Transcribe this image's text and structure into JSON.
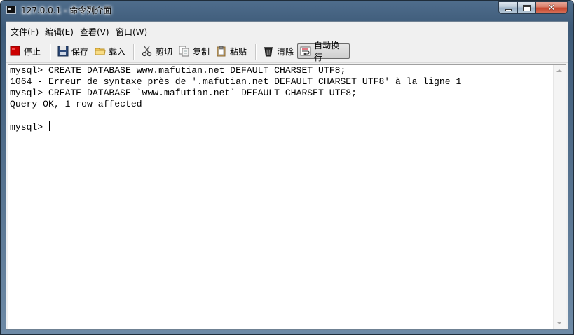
{
  "window": {
    "title": "127.0.0.1 - 命令列介面"
  },
  "menu": [
    {
      "label": "文件(F)"
    },
    {
      "label": "编辑(E)"
    },
    {
      "label": "查看(V)"
    },
    {
      "label": "窗口(W)"
    }
  ],
  "toolbar": {
    "stop": "停止",
    "save": "保存",
    "load": "载入",
    "cut": "剪切",
    "copy": "复制",
    "paste": "粘贴",
    "clear": "清除",
    "wrap": "自动换行"
  },
  "console": {
    "lines": [
      "mysql> CREATE DATABASE www.mafutian.net DEFAULT CHARSET UTF8;",
      "1064 - Erreur de syntaxe près de '.mafutian.net DEFAULT CHARSET UTF8' à la ligne 1",
      "mysql> CREATE DATABASE `www.mafutian.net` DEFAULT CHARSET UTF8;",
      "Query OK, 1 row affected",
      "",
      "mysql> "
    ]
  },
  "colors": {
    "titlebar": "#4f6d8c",
    "stop_icon": "#cc0000",
    "close_button": "#c4432b"
  },
  "icons": [
    "console-app-icon",
    "stop-icon",
    "save-icon",
    "folder-icon",
    "scissors-icon",
    "copy-icon",
    "paste-icon",
    "clear-icon",
    "wrap-icon"
  ]
}
